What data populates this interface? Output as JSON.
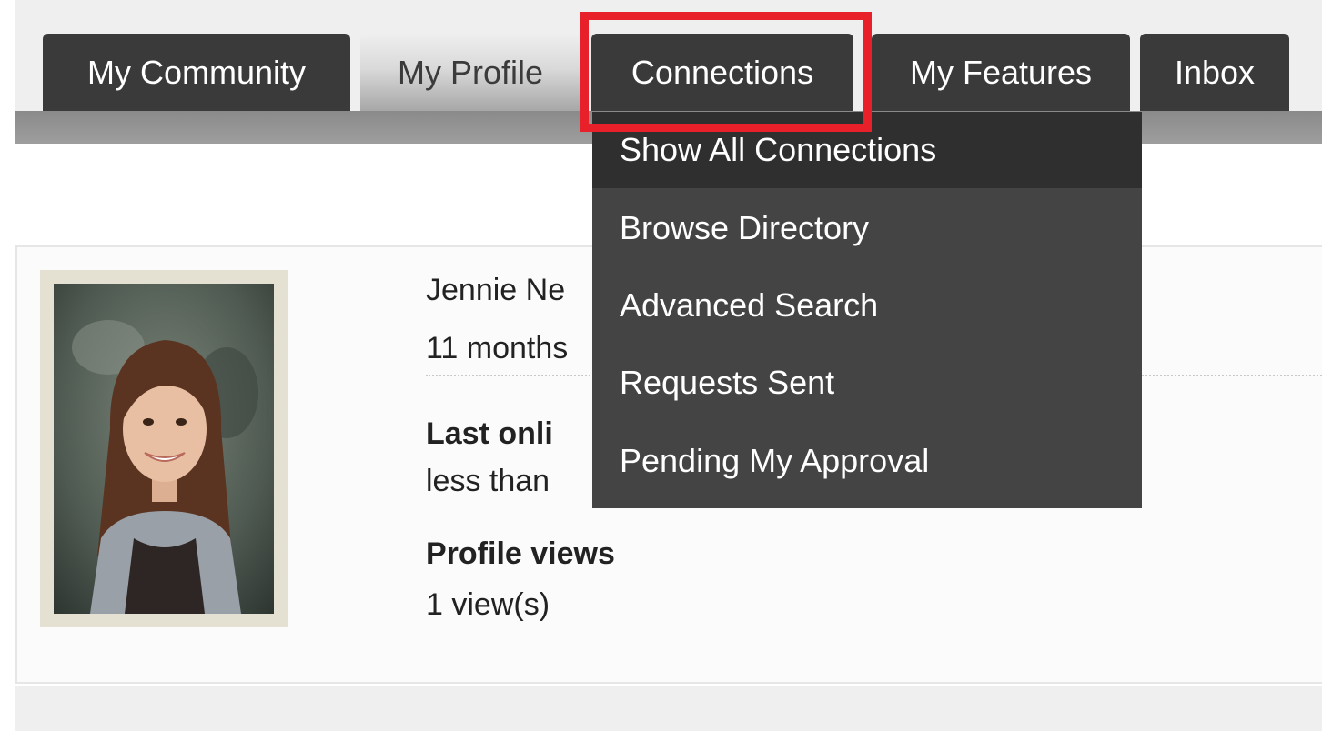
{
  "tabs": [
    {
      "label": "My Community"
    },
    {
      "label": "My Profile"
    },
    {
      "label": "Connections"
    },
    {
      "label": "My Features"
    },
    {
      "label": "Inbox"
    }
  ],
  "dropdown": {
    "items": [
      {
        "label": "Show All Connections"
      },
      {
        "label": "Browse Directory"
      },
      {
        "label": "Advanced Search"
      },
      {
        "label": "Requests Sent"
      },
      {
        "label": "Pending My Approval"
      }
    ]
  },
  "profile": {
    "name": "Jennie Ne",
    "member_since": "11 months",
    "last_online_label": "Last onli",
    "last_online_value": "less than",
    "views_label": "Profile views",
    "views_value": "1 view(s)"
  },
  "colors": {
    "tab_bg": "#3a3a3a",
    "dropdown_bg": "#444444",
    "dropdown_hover": "#2f2f2f",
    "highlight": "#e8202a"
  }
}
